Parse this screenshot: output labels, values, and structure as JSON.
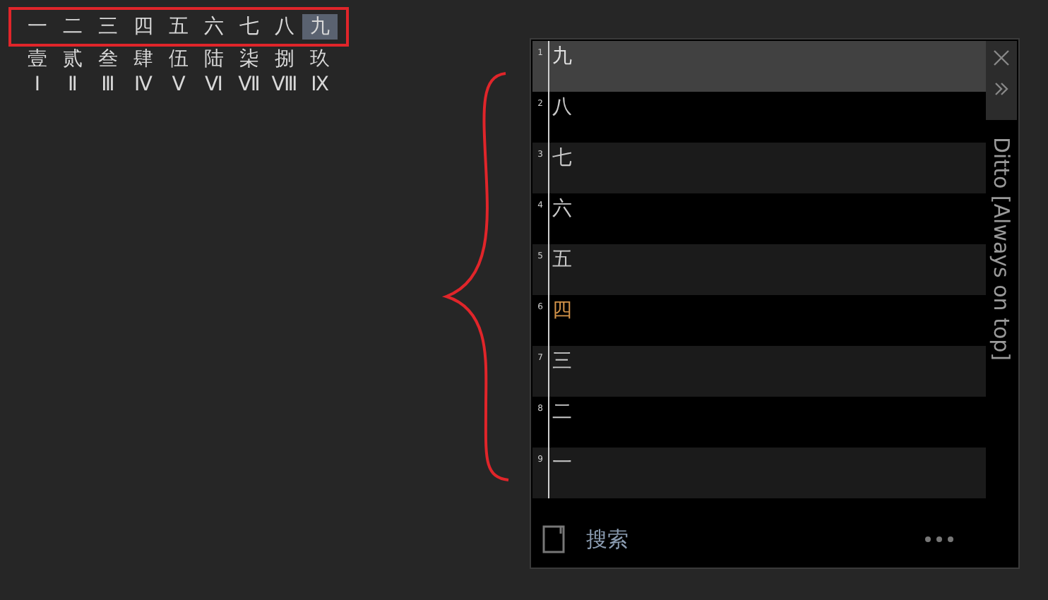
{
  "numeral_rows": [
    {
      "items": [
        {
          "text": "一",
          "selected": false
        },
        {
          "text": "二",
          "selected": false
        },
        {
          "text": "三",
          "selected": false
        },
        {
          "text": "四",
          "selected": false
        },
        {
          "text": "五",
          "selected": false
        },
        {
          "text": "六",
          "selected": false
        },
        {
          "text": "七",
          "selected": false
        },
        {
          "text": "八",
          "selected": false
        },
        {
          "text": "九",
          "selected": true
        }
      ]
    },
    {
      "items": [
        {
          "text": "壹",
          "selected": false
        },
        {
          "text": "贰",
          "selected": false
        },
        {
          "text": "叁",
          "selected": false
        },
        {
          "text": "肆",
          "selected": false
        },
        {
          "text": "伍",
          "selected": false
        },
        {
          "text": "陆",
          "selected": false
        },
        {
          "text": "柒",
          "selected": false
        },
        {
          "text": "捌",
          "selected": false
        },
        {
          "text": "玖",
          "selected": false
        }
      ]
    },
    {
      "items": [
        {
          "text": "Ⅰ",
          "selected": false
        },
        {
          "text": "Ⅱ",
          "selected": false
        },
        {
          "text": "Ⅲ",
          "selected": false
        },
        {
          "text": "Ⅳ",
          "selected": false
        },
        {
          "text": "Ⅴ",
          "selected": false
        },
        {
          "text": "Ⅵ",
          "selected": false
        },
        {
          "text": "Ⅶ",
          "selected": false
        },
        {
          "text": "Ⅷ",
          "selected": false
        },
        {
          "text": "Ⅸ",
          "selected": false
        }
      ]
    }
  ],
  "clip_window": {
    "title": "Ditto [Always on top]",
    "clips": [
      {
        "number": "1",
        "text": "九",
        "selected": true,
        "color": "#e0e0e0"
      },
      {
        "number": "2",
        "text": "八",
        "selected": false,
        "color": "#c8c8c8"
      },
      {
        "number": "3",
        "text": "七",
        "selected": false,
        "color": "#c8c8c8"
      },
      {
        "number": "4",
        "text": "六",
        "selected": false,
        "color": "#c8c8c8"
      },
      {
        "number": "5",
        "text": "五",
        "selected": false,
        "color": "#c8c8c8"
      },
      {
        "number": "6",
        "text": "四",
        "selected": false,
        "color": "#d4944a"
      },
      {
        "number": "7",
        "text": "三",
        "selected": false,
        "color": "#c8c8c8"
      },
      {
        "number": "8",
        "text": "二",
        "selected": false,
        "color": "#c8c8c8"
      },
      {
        "number": "9",
        "text": "一",
        "selected": false,
        "color": "#c8c8c8"
      }
    ],
    "search": {
      "placeholder": "搜索"
    }
  }
}
